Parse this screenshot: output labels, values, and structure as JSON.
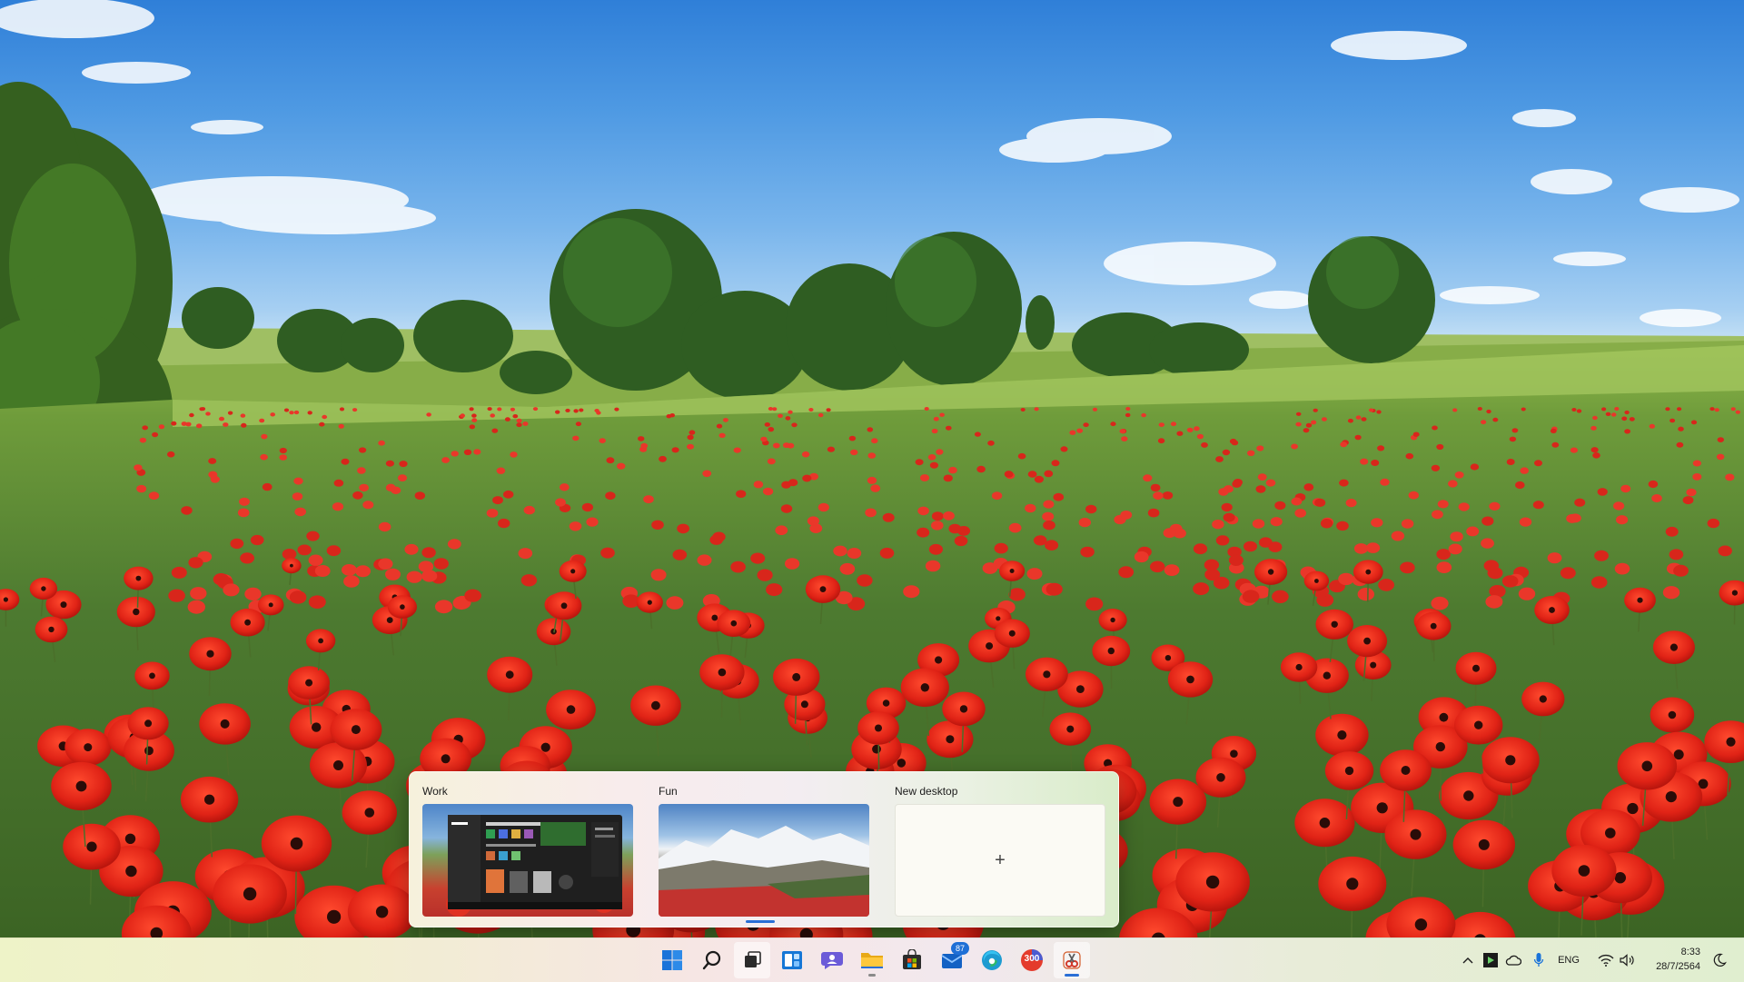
{
  "task_view": {
    "desktops": [
      {
        "label": "Work"
      },
      {
        "label": "Fun"
      },
      {
        "label": "New desktop",
        "plus": "+"
      }
    ]
  },
  "taskbar": {
    "icons": [
      {
        "name": "start-icon"
      },
      {
        "name": "search-icon"
      },
      {
        "name": "task-view-icon"
      },
      {
        "name": "widgets-icon"
      },
      {
        "name": "chat-icon"
      },
      {
        "name": "file-explorer-icon"
      },
      {
        "name": "store-icon"
      },
      {
        "name": "mail-icon",
        "badge": "87"
      },
      {
        "name": "edge-icon"
      },
      {
        "name": "app-300-icon",
        "label": "300"
      },
      {
        "name": "snipping-tool-icon"
      }
    ],
    "tray": {
      "language": "ENG",
      "time": "8:33",
      "date": "28/7/2564"
    }
  },
  "colors": {
    "accent": "#2a6fd6",
    "poppy": "#d8261b",
    "grass": "#4f7d34"
  }
}
